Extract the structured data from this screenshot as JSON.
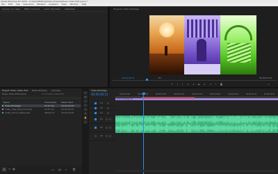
{
  "window": {
    "title": "Adobe Premiere Pro 2020 - C:\\Users\\Editing\\Video Projects\\Music Video Edit.prproj *"
  },
  "menu": {
    "items": [
      "File",
      "Edit",
      "Clip",
      "Sequence",
      "Markers",
      "Graphics",
      "View",
      "Window",
      "Help"
    ]
  },
  "source_panel": {
    "tabs": [
      "Source: (no clips)",
      "Effect Controls",
      "Audio Clip Mixer",
      "Metadata"
    ]
  },
  "program_panel": {
    "tab": "Program: Video Montage",
    "left_timecode": "00;00;08;13",
    "fit_label": "Fit",
    "right_timecode": "00;00;33;18",
    "ruler_label": "00;00;15;00"
  },
  "project_panel": {
    "tabs": [
      "Project: Music Video Edit",
      "Media Browser",
      "Libraries"
    ],
    "file_name": "Music Video Edit.prproj",
    "item_count": "1 of 3 items selected",
    "col_name": "Name",
    "col_rate": "Frame Rate",
    "col_start": "Media Start",
    "items": [
      {
        "name": "Video Montage",
        "rate": "29.97 fps",
        "start": "00;00;00;00"
      },
      {
        "name": "video_clips_final_mix.mp4",
        "rate": "29.97 fps",
        "start": "00;00;00;00"
      },
      {
        "name": "audio_track_master.wav",
        "rate": "48000 Hz",
        "start": "00;00;00;00"
      }
    ]
  },
  "timeline": {
    "tab": "Video Montage",
    "timecode": "00;00;08;13",
    "ruler_labels": [
      "00;00;04;00",
      "00;00;08;00",
      "00;00;12;00",
      "00;00;16;00",
      "00;00;20;00",
      "00;00;24;00",
      "00;00;28;00",
      "00;00;32;00",
      "00;00;36;00"
    ],
    "tracks": [
      "V3",
      "V2",
      "V1",
      "A1",
      "A2",
      "A3"
    ],
    "video_clip": "Video Montage [V]",
    "playhead_fraction": 0.17
  },
  "tools": {
    "icons": [
      "selection-tool",
      "track-select-tool",
      "ripple-edit-tool",
      "razor-tool",
      "slip-tool",
      "pen-tool",
      "hand-tool",
      "type-tool"
    ],
    "glyphs": [
      "▸",
      "▸▸",
      "⇿",
      "✂",
      "↔",
      "✎",
      "✋",
      "T"
    ]
  },
  "colors": {
    "accent_blue": "#2d8ceb",
    "audio_clip": "#3fb27f",
    "audio_wave": "#66e3a8",
    "video_clip": "#a28ad8",
    "work_area": "#d8486b"
  }
}
